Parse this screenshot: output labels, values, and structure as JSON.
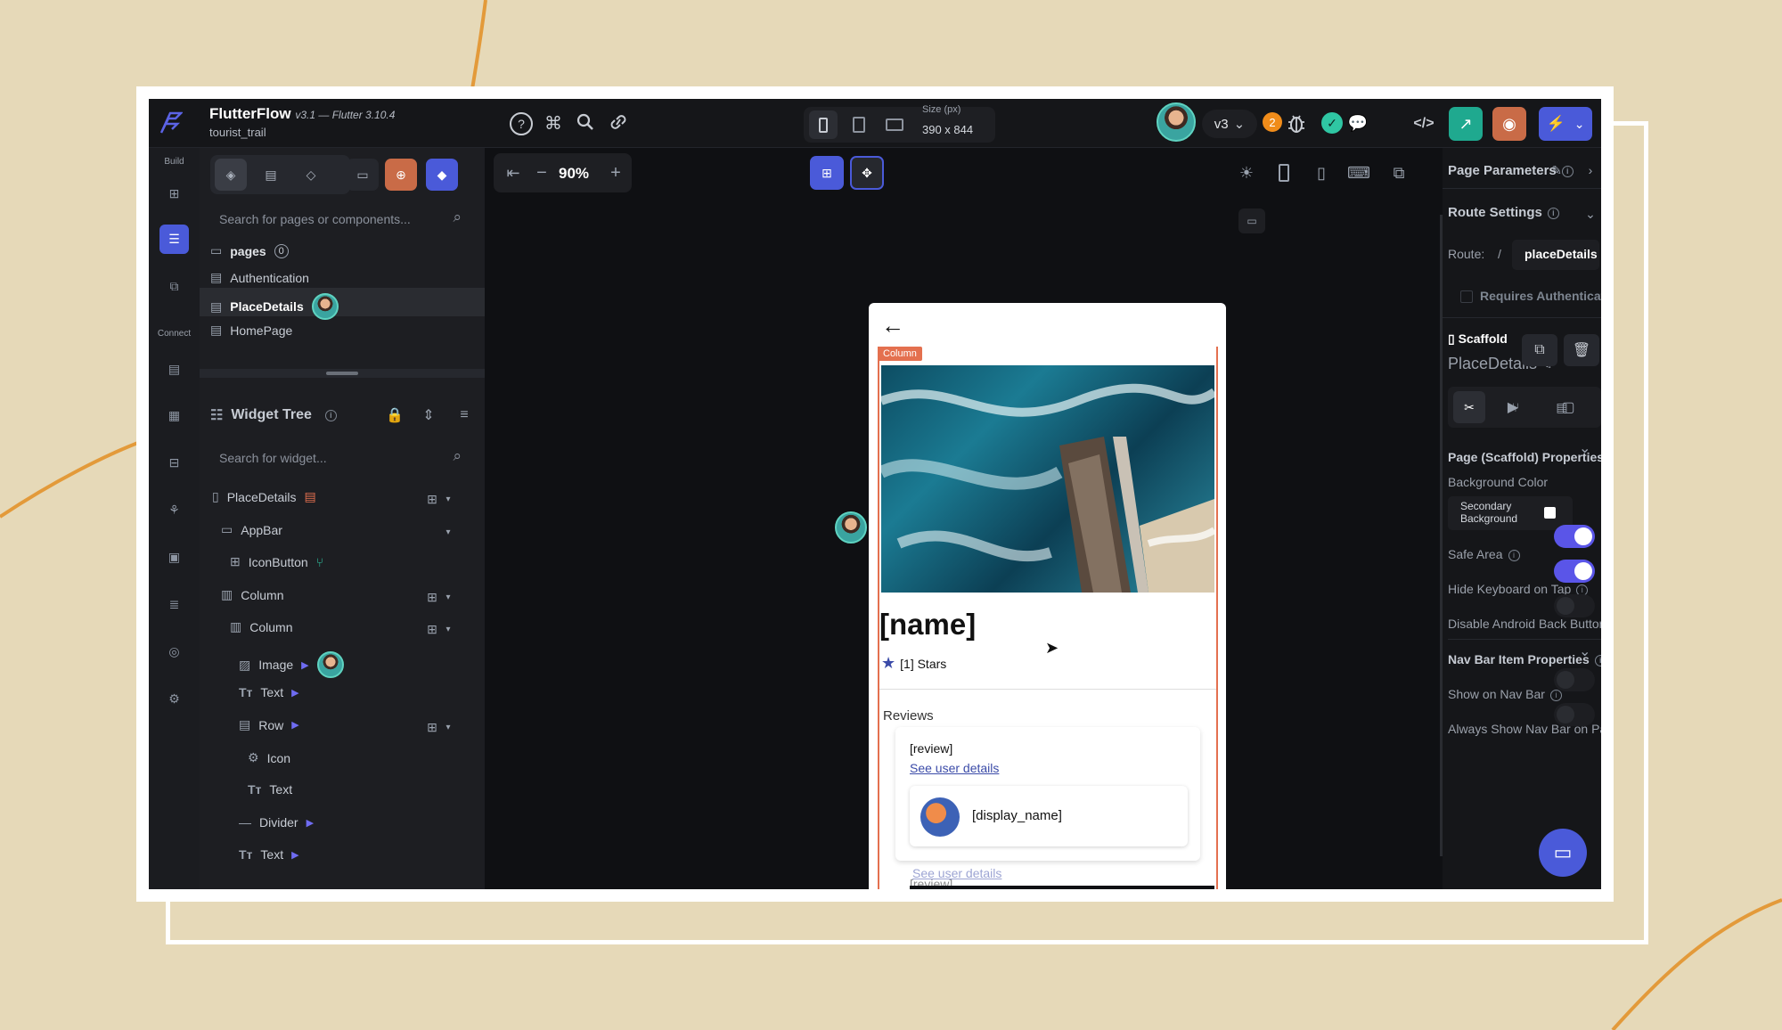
{
  "app": {
    "name": "FlutterFlow",
    "version": "v3.1 — Flutter 3.10.4",
    "project": "tourist_trail"
  },
  "topbar": {
    "size_label": "Size (px)",
    "size_value": "390 x 844",
    "version_badge": "v3",
    "notification_count": "2"
  },
  "rail": {
    "build_label": "Build",
    "connect_label": "Connect"
  },
  "left_panel": {
    "search_pages_placeholder": "Search for pages or components...",
    "pages_label": "pages",
    "pages": [
      "Authentication",
      "PlaceDetails",
      "HomePage"
    ],
    "widget_tree_title": "Widget Tree",
    "search_widget_placeholder": "Search for widget...",
    "tree": [
      {
        "label": "PlaceDetails"
      },
      {
        "label": "AppBar"
      },
      {
        "label": "IconButton"
      },
      {
        "label": "Column"
      },
      {
        "label": "Column"
      },
      {
        "label": "Image"
      },
      {
        "label": "Text"
      },
      {
        "label": "Row"
      },
      {
        "label": "Icon"
      },
      {
        "label": "Text"
      },
      {
        "label": "Divider"
      },
      {
        "label": "Text"
      }
    ]
  },
  "canvas": {
    "zoom": "90%",
    "column_tag": "Column",
    "place_name": "[name]",
    "stars_text": "[1] Stars",
    "reviews_label": "Reviews",
    "review_text": "[review]",
    "see_user_details": "See user details",
    "display_name": "[display_name]"
  },
  "right_panel": {
    "page_parameters": "Page Parameters",
    "route_settings": "Route Settings",
    "route_label": "Route:",
    "route_slash": "/",
    "route_value": "placeDetails",
    "requires_auth": "Requires Authentication",
    "scaffold_label": "Scaffold",
    "scaffold_name": "PlaceDetails",
    "page_props_title": "Page (Scaffold) Properties",
    "bg_color_label": "Background Color",
    "bg_color_value": "Secondary Background",
    "safe_area": "Safe Area",
    "hide_keyboard": "Hide Keyboard on Tap",
    "disable_back": "Disable Android Back Button",
    "nav_bar_title": "Nav Bar Item Properties",
    "show_nav_bar": "Show on Nav Bar",
    "always_show_nav": "Always Show Nav Bar on Page"
  },
  "toggles": {
    "safe_area": true,
    "hide_keyboard": true,
    "disable_back": false,
    "show_nav_bar": false,
    "always_show_nav": false
  },
  "colors": {
    "accent": "#4a5ad9",
    "toggle_on": "#5a55e8",
    "selection_outline": "#e4704f",
    "background": "#e6d9b8",
    "deco_stroke": "#e39a3a"
  }
}
